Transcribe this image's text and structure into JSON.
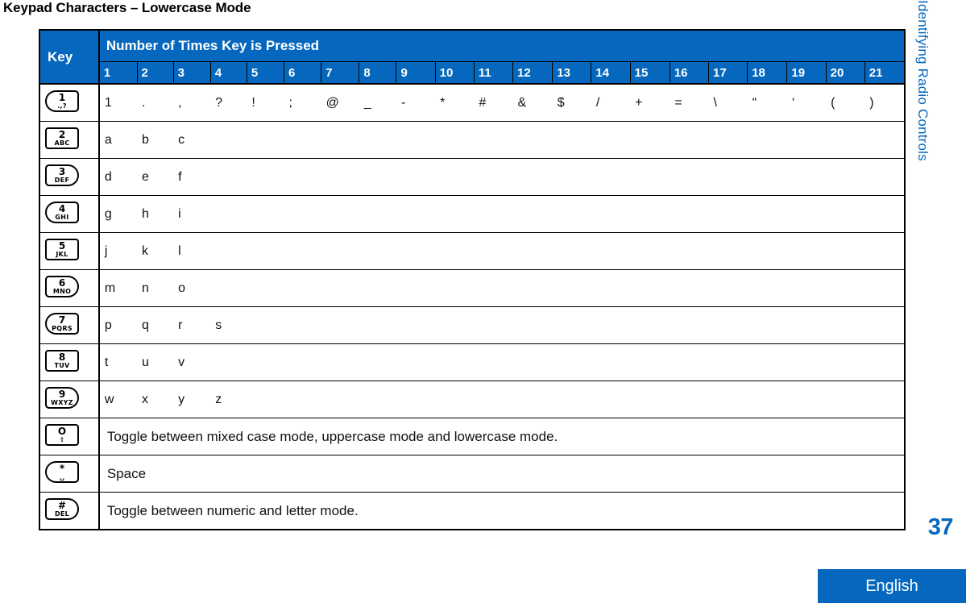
{
  "page": {
    "title": "Keypad Characters – Lowercase Mode",
    "side_tab": "Identifying Radio Controls",
    "page_number": "37",
    "language_banner": "English"
  },
  "colors": {
    "accent_blue": "#0568BE",
    "header_text": "#FFFFFF",
    "body_text": "#111111",
    "border": "#000000"
  },
  "table": {
    "header": {
      "key_label": "Key",
      "span_label": "Number of Times Key is Pressed",
      "press_counts": [
        "1",
        "2",
        "3",
        "4",
        "5",
        "6",
        "7",
        "8",
        "9",
        "10",
        "11",
        "12",
        "13",
        "14",
        "15",
        "16",
        "17",
        "18",
        "19",
        "20",
        "21"
      ]
    },
    "rows": [
      {
        "key": {
          "top": "1",
          "bottom": ".,?",
          "shape": "round-left",
          "icon_name": "key-1-icon"
        },
        "type": "chars",
        "chars": [
          "1",
          ".",
          ",",
          "?",
          "!",
          ";",
          "@",
          "_",
          "-",
          "*",
          "#",
          "&",
          "$",
          "/",
          "+",
          "=",
          "\\",
          "“",
          "‘",
          "(",
          ")"
        ]
      },
      {
        "key": {
          "top": "2",
          "bottom": "ABC",
          "shape": "square",
          "icon_name": "key-2-icon"
        },
        "type": "chars",
        "chars": [
          "a",
          "b",
          "c"
        ]
      },
      {
        "key": {
          "top": "3",
          "bottom": "DEF",
          "shape": "round-right",
          "icon_name": "key-3-icon"
        },
        "type": "chars",
        "chars": [
          "d",
          "e",
          "f"
        ]
      },
      {
        "key": {
          "top": "4",
          "bottom": "GHI",
          "shape": "round-left",
          "icon_name": "key-4-icon"
        },
        "type": "chars",
        "chars": [
          "g",
          "h",
          "i"
        ]
      },
      {
        "key": {
          "top": "5",
          "bottom": "JKL",
          "shape": "square",
          "icon_name": "key-5-icon"
        },
        "type": "chars",
        "chars": [
          "j",
          "k",
          "l"
        ]
      },
      {
        "key": {
          "top": "6",
          "bottom": "MNO",
          "shape": "round-right",
          "icon_name": "key-6-icon"
        },
        "type": "chars",
        "chars": [
          "m",
          "n",
          "o"
        ]
      },
      {
        "key": {
          "top": "7",
          "bottom": "PQRS",
          "shape": "round-left",
          "icon_name": "key-7-icon"
        },
        "type": "chars",
        "chars": [
          "p",
          "q",
          "r",
          "s"
        ]
      },
      {
        "key": {
          "top": "8",
          "bottom": "TUV",
          "shape": "square",
          "icon_name": "key-8-icon"
        },
        "type": "chars",
        "chars": [
          "t",
          "u",
          "v"
        ]
      },
      {
        "key": {
          "top": "9",
          "bottom": "WXYZ",
          "shape": "round-right",
          "icon_name": "key-9-icon"
        },
        "type": "chars",
        "chars": [
          "w",
          "x",
          "y",
          "z"
        ]
      },
      {
        "key": {
          "top": "O",
          "bottom": "⇧",
          "shape": "square",
          "icon_name": "key-0-shift-icon"
        },
        "type": "description",
        "description": "Toggle between mixed case mode, uppercase mode and lowercase mode."
      },
      {
        "key": {
          "top": "*",
          "bottom": "␣",
          "shape": "round-left",
          "icon_name": "key-star-space-icon"
        },
        "type": "description",
        "description": "Space"
      },
      {
        "key": {
          "top": "#",
          "bottom": "DEL",
          "shape": "round-right",
          "icon_name": "key-hash-del-icon"
        },
        "type": "description",
        "description": "Toggle between numeric and letter mode."
      }
    ]
  }
}
